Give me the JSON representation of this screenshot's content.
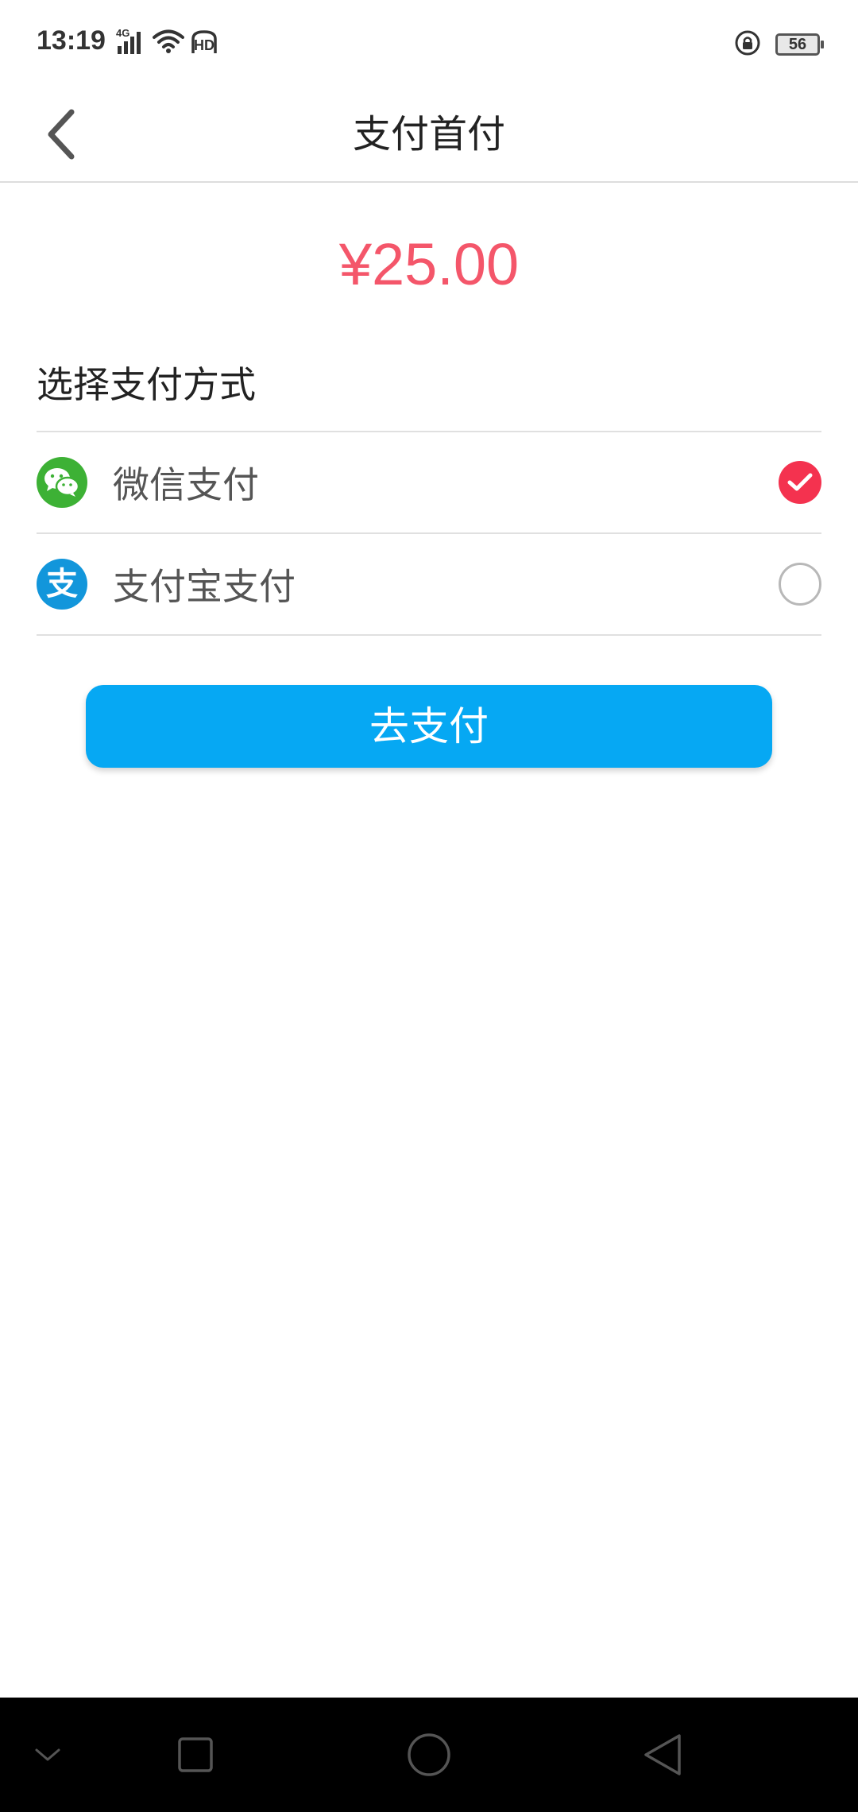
{
  "status_bar": {
    "time": "13:19",
    "network": "4G",
    "hd": "HD",
    "battery_level": "56"
  },
  "header": {
    "title": "支付首付"
  },
  "payment": {
    "amount": "¥25.00",
    "section_title": "选择支付方式",
    "methods": [
      {
        "label": "微信支付",
        "selected": true,
        "color": "#3db135"
      },
      {
        "label": "支付宝支付",
        "selected": false,
        "color": "#1296db"
      }
    ],
    "submit_label": "去支付",
    "accent_color": "#f4566a",
    "button_color": "#06a8f3"
  },
  "icons": {
    "alipay_glyph": "支"
  }
}
